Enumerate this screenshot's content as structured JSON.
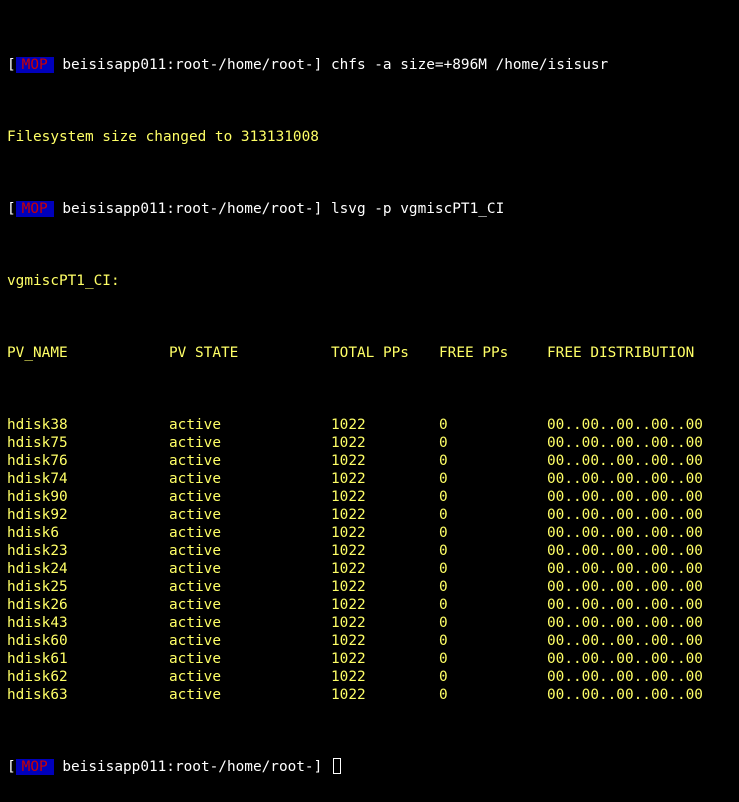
{
  "prompt": {
    "open": "[",
    "tag": "MOP",
    "host_path": "beisisapp011:root-/home/root-",
    "close": "]"
  },
  "commands": [
    "chfs -a size=+896M /home/isisusr",
    "lsvg -p vgmiscPT1_CI"
  ],
  "chfs_output": "Filesystem size changed to 313131008",
  "vg_label": "vgmiscPT1_CI:",
  "table": {
    "headers": [
      "PV_NAME",
      "PV STATE",
      "TOTAL PPs",
      "FREE PPs",
      "FREE DISTRIBUTION"
    ],
    "rows": [
      [
        "hdisk38",
        "active",
        "1022",
        "0",
        "00..00..00..00..00"
      ],
      [
        "hdisk75",
        "active",
        "1022",
        "0",
        "00..00..00..00..00"
      ],
      [
        "hdisk76",
        "active",
        "1022",
        "0",
        "00..00..00..00..00"
      ],
      [
        "hdisk74",
        "active",
        "1022",
        "0",
        "00..00..00..00..00"
      ],
      [
        "hdisk90",
        "active",
        "1022",
        "0",
        "00..00..00..00..00"
      ],
      [
        "hdisk92",
        "active",
        "1022",
        "0",
        "00..00..00..00..00"
      ],
      [
        "hdisk6",
        "active",
        "1022",
        "0",
        "00..00..00..00..00"
      ],
      [
        "hdisk23",
        "active",
        "1022",
        "0",
        "00..00..00..00..00"
      ],
      [
        "hdisk24",
        "active",
        "1022",
        "0",
        "00..00..00..00..00"
      ],
      [
        "hdisk25",
        "active",
        "1022",
        "0",
        "00..00..00..00..00"
      ],
      [
        "hdisk26",
        "active",
        "1022",
        "0",
        "00..00..00..00..00"
      ],
      [
        "hdisk43",
        "active",
        "1022",
        "0",
        "00..00..00..00..00"
      ],
      [
        "hdisk60",
        "active",
        "1022",
        "0",
        "00..00..00..00..00"
      ],
      [
        "hdisk61",
        "active",
        "1022",
        "0",
        "00..00..00..00..00"
      ],
      [
        "hdisk62",
        "active",
        "1022",
        "0",
        "00..00..00..00..00"
      ],
      [
        "hdisk63",
        "active",
        "1022",
        "0",
        "00..00..00..00..00"
      ]
    ]
  },
  "colors": {
    "background": "#000000",
    "output_text": "#ffff66",
    "prompt_text": "#ffffff",
    "tag_background": "#0000bb",
    "tag_text": "#cc0000"
  }
}
